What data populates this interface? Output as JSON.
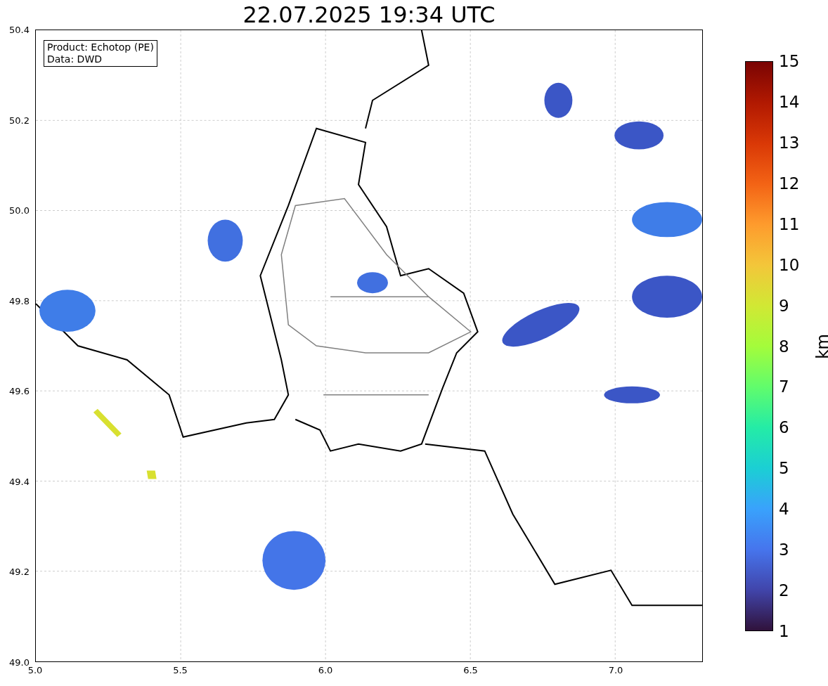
{
  "title": "22.07.2025 19:34 UTC",
  "legend": [
    "Product: Echotop (PE)",
    "Data: DWD"
  ],
  "y_ticks": [
    "50.4",
    "50.2",
    "50.0",
    "49.8",
    "49.6",
    "49.4",
    "49.2",
    "49.0"
  ],
  "x_ticks": [
    "5.0",
    "5.5",
    "6.0",
    "6.5",
    "7.0"
  ],
  "colorbar": {
    "label": "km",
    "ticks": [
      "15",
      "14",
      "13",
      "12",
      "11",
      "10",
      "9",
      "8",
      "7",
      "6",
      "5",
      "4",
      "3",
      "2",
      "1"
    ]
  }
}
